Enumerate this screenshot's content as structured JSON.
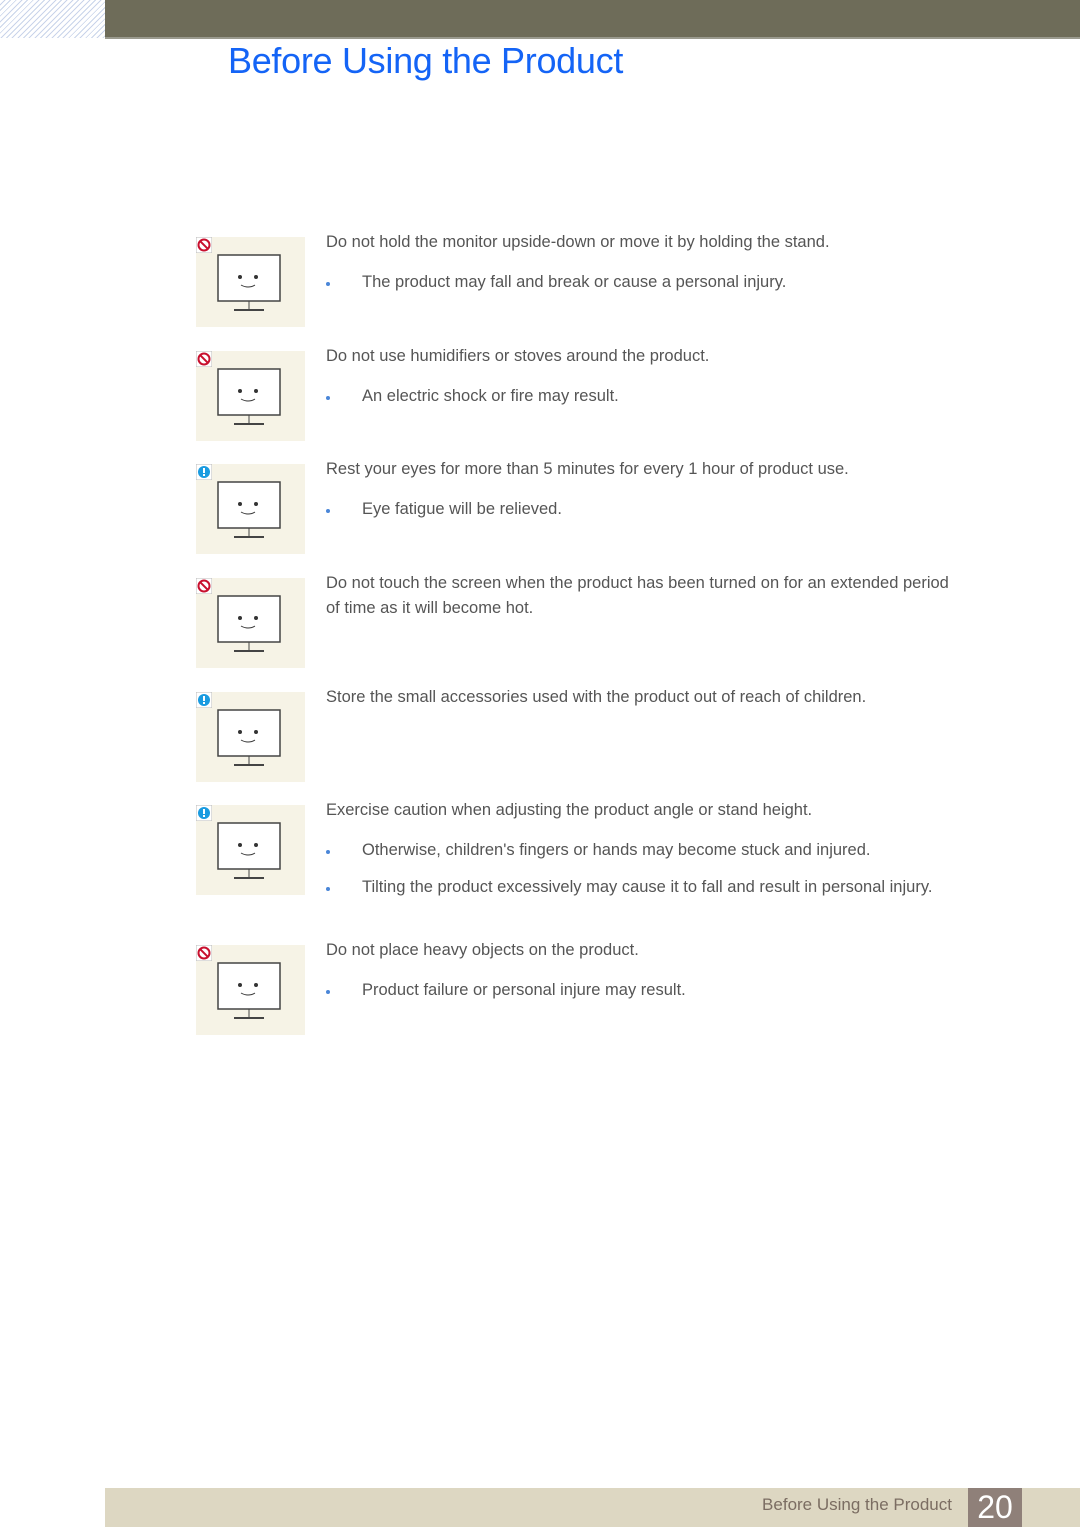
{
  "header": {
    "title": "Before Using the Product"
  },
  "items": [
    {
      "icon": "prohibited",
      "illustration": "monitor-held-by-stand",
      "text": "Do not hold the monitor upside-down or move it by holding the stand.",
      "bullets": [
        "The product may fall and break or cause a personal injury."
      ]
    },
    {
      "icon": "prohibited",
      "illustration": "monitor-near-humidifier",
      "text": "Do not use humidifiers or stoves around the product.",
      "bullets": [
        "An electric shock or fire may result."
      ]
    },
    {
      "icon": "caution",
      "illustration": "monitor-eye-rest",
      "text": "Rest your eyes for more than 5 minutes for every 1 hour of product use.",
      "bullets": [
        "Eye fatigue will be relieved."
      ]
    },
    {
      "icon": "prohibited",
      "illustration": "hand-touching-hot-screen",
      "text": "Do not touch the screen when the product has been turned on for an extended period of time as it will become hot.",
      "bullets": []
    },
    {
      "icon": "caution",
      "illustration": "child-reaching-shelf",
      "text": "Store the small accessories used with the product out of reach of children.",
      "bullets": []
    },
    {
      "icon": "caution",
      "illustration": "hands-adjusting-stand",
      "text": "Exercise caution when adjusting the product angle or stand height.",
      "bullets": [
        "Otherwise, children's fingers or hands may become stuck and injured.",
        "Tilting the product excessively may cause it to fall and result in personal injury."
      ]
    },
    {
      "icon": "prohibited",
      "illustration": "objects-on-monitor",
      "text": "Do not place heavy objects on the product.",
      "bullets": [
        "Product failure or personal injure may result."
      ]
    }
  ],
  "footer": {
    "section": "Before Using the Product",
    "page": "20"
  },
  "colors": {
    "title": "#1464f6",
    "topbar": "#6e6c59",
    "footer": "#ddd7c2",
    "page_badge": "#8f8079",
    "prohibited": "#c8102e",
    "caution": "#1a9be0"
  }
}
